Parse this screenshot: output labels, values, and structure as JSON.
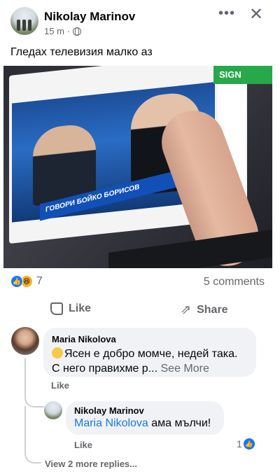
{
  "post": {
    "author": "Nikolay Marinov",
    "time": "15 m",
    "separator": "·",
    "audience_icon": "globe-icon",
    "text": "Гледах телевизия малко аз",
    "more_icon": "•••",
    "close_icon": "✕"
  },
  "photo": {
    "lower_third": "ГОВОРИ БОЙКО БОРИСОВ",
    "sign_label": "SIGN"
  },
  "stats": {
    "reaction_count": "7",
    "comments": "5 comments"
  },
  "actions": {
    "like": "Like",
    "share": "Share"
  },
  "comment": {
    "author": "Maria Nikolova",
    "text": "Ясен е добро момче, недей така. С него правихме р...",
    "see_more": "See More",
    "like": "Like"
  },
  "reply": {
    "author": "Nikolay Marinov",
    "mention": "Maria Nikolova",
    "text": " ама мълчи!",
    "like": "Like",
    "like_count": "1"
  },
  "view_more": "View 2 more replies...",
  "colors": {
    "accent": "#1877f2",
    "muted": "#65676b",
    "bubble": "#f0f2f5"
  }
}
